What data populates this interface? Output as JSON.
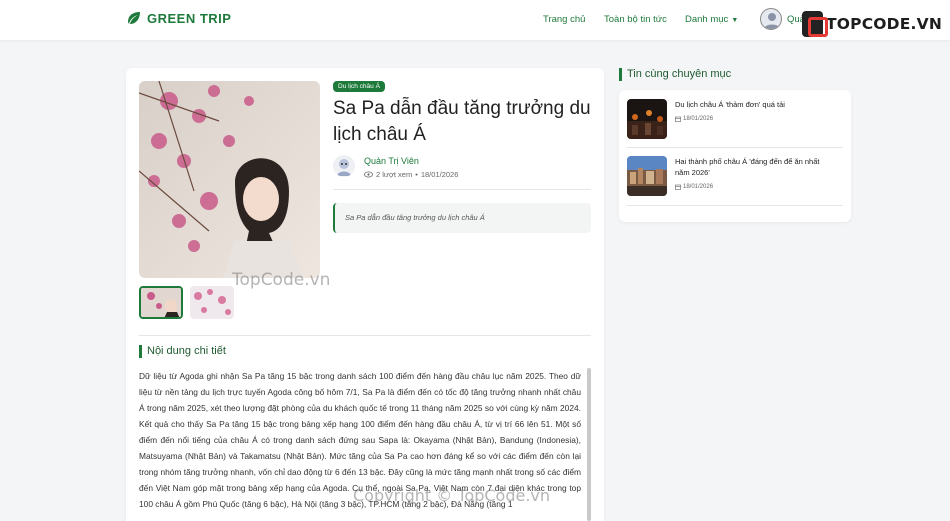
{
  "nav": {
    "brand": "GREEN TRIP",
    "links": [
      "Trang chủ",
      "Toàn bộ tin tức",
      "Danh mục"
    ],
    "user_name": "Quả"
  },
  "logo_watermark": "TOPCODE.VN",
  "article": {
    "category_badge": "Du lịch châu Á",
    "title": "Sa Pa dẫn đầu tăng trưởng du lịch châu Á",
    "author": "Quản Trị Viên",
    "views": "2 lượt xem",
    "date": "18/01/2026",
    "summary": "Sa Pa dẫn đầu tăng trưởng du lịch châu Á",
    "section_title": "Nội dung chi tiết",
    "content": "Dữ liệu từ Agoda ghi nhận Sa Pa tăng 15 bậc trong danh sách 100 điểm đến hàng đầu châu lục năm 2025. Theo dữ liệu từ nền tảng du lịch trực tuyến Agoda công bố hôm 7/1, Sa Pa là điểm đến có tốc độ tăng trưởng nhanh nhất châu Á trong năm 2025, xét theo lượng đặt phòng của du khách quốc tế trong 11 tháng năm 2025 so với cùng kỳ năm 2024. Kết quả cho thấy Sa Pa tăng 15 bậc trong bảng xếp hạng 100 điểm đến hàng đầu châu Á, từ vị trí 66 lên 51. Một số điểm đến nổi tiếng của châu Á có trong danh sách đứng sau Sapa là: Okayama (Nhật Bản), Bandung (Indonesia), Matsuyama (Nhật Bản) và Takamatsu (Nhật Bản). Mức tăng của Sa Pa cao hơn đáng kể so với các điểm đến còn lại trong nhóm tăng trưởng nhanh, vốn chỉ dao động từ 6 đến 13 bậc. Đây cũng là mức tăng mạnh nhất trong số các điểm đến Việt Nam góp mặt trong bảng xếp hạng của Agoda. Cụ thể, ngoài Sa Pa, Việt Nam còn 7 đại diện khác trong top 100 châu Á gồm Phú Quốc (tăng 6 bậc), Hà Nội (tăng 3 bậc), TP.HCM (tăng 2 bậc), Đà Nẵng (tăng 1"
  },
  "sidebar": {
    "title": "Tin cùng chuyên mục",
    "items": [
      {
        "title": "Du lịch châu Á 'thảm đơn' quá tải",
        "date": "18/01/2026"
      },
      {
        "title": "Hai thành phố châu Á 'đáng đến để ăn nhất năm 2026'",
        "date": "18/01/2026"
      }
    ]
  },
  "watermarks": [
    "TopCode.vn",
    "Copyright © TopCode.vn"
  ],
  "colors": {
    "accent": "#1e7a3b",
    "background": "#f4f5f7"
  },
  "icons": [
    "leaf-icon",
    "caret-down-icon",
    "eye-icon",
    "calendar-icon"
  ]
}
